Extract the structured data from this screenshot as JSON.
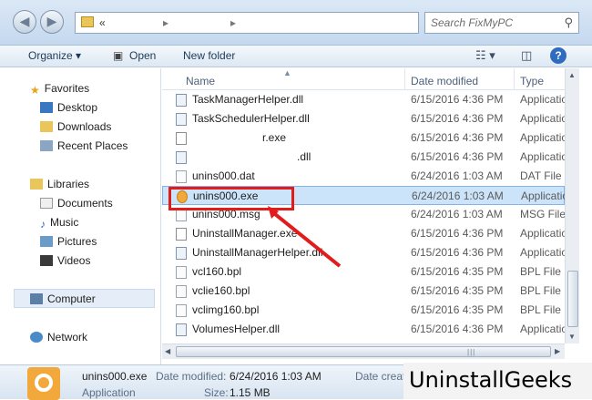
{
  "address": {
    "chevron": "«",
    "crumb_sep": "▸",
    "search_placeholder": "Search FixMyPC"
  },
  "toolbar": {
    "organize": "Organize",
    "open": "Open",
    "new_folder": "New folder"
  },
  "nav": {
    "favorites": "Favorites",
    "desktop": "Desktop",
    "downloads": "Downloads",
    "recent": "Recent Places",
    "libraries": "Libraries",
    "documents": "Documents",
    "music": "Music",
    "pictures": "Pictures",
    "videos": "Videos",
    "computer": "Computer",
    "network": "Network"
  },
  "columns": {
    "name": "Name",
    "date": "Date modified",
    "type": "Type"
  },
  "files": [
    {
      "name": "TaskManagerHelper.dll",
      "date": "6/15/2016 4:36 PM",
      "type": "Applicatio",
      "icon": "dll-icon"
    },
    {
      "name": "TaskSchedulerHelper.dll",
      "date": "6/15/2016 4:36 PM",
      "type": "Applicatio",
      "icon": "dll-icon"
    },
    {
      "name": "r.exe",
      "date": "6/15/2016 4:36 PM",
      "type": "Applicatio",
      "icon": "exe-icon"
    },
    {
      "name": ".dll",
      "date": "6/15/2016 4:36 PM",
      "type": "Applicatio",
      "icon": "dll-icon"
    },
    {
      "name": "unins000.dat",
      "date": "6/24/2016 1:03 AM",
      "type": "DAT File",
      "icon": "file-icon"
    },
    {
      "name": "unins000.exe",
      "date": "6/24/2016 1:03 AM",
      "type": "Applicatio",
      "icon": "installer-icon"
    },
    {
      "name": "unins000.msg",
      "date": "6/24/2016 1:03 AM",
      "type": "MSG File",
      "icon": "file-icon"
    },
    {
      "name": "UninstallManager.exe",
      "date": "6/15/2016 4:36 PM",
      "type": "Applicatio",
      "icon": "exe-icon"
    },
    {
      "name": "UninstallManagerHelper.dll",
      "date": "6/15/2016 4:36 PM",
      "type": "Applicatio",
      "icon": "dll-icon"
    },
    {
      "name": "vcl160.bpl",
      "date": "6/15/2016 4:35 PM",
      "type": "BPL File",
      "icon": "file-icon"
    },
    {
      "name": "vclie160.bpl",
      "date": "6/15/2016 4:35 PM",
      "type": "BPL File",
      "icon": "file-icon"
    },
    {
      "name": "vclimg160.bpl",
      "date": "6/15/2016 4:35 PM",
      "type": "BPL File",
      "icon": "file-icon"
    },
    {
      "name": "VolumesHelper.dll",
      "date": "6/15/2016 4:36 PM",
      "type": "Applicatio",
      "icon": "dll-icon"
    }
  ],
  "details": {
    "name": "unins000.exe",
    "type": "Application",
    "date_label": "Date modified:",
    "date_value": "6/24/2016 1:03 AM",
    "size_label": "Size:",
    "size_value": "1.15 MB",
    "created_label": "Date create"
  },
  "watermark": "UninstallGeeks",
  "colors": {
    "selection": "#cce4f9",
    "highlight": "#e21b1b",
    "accent": "#2f6cbf"
  }
}
